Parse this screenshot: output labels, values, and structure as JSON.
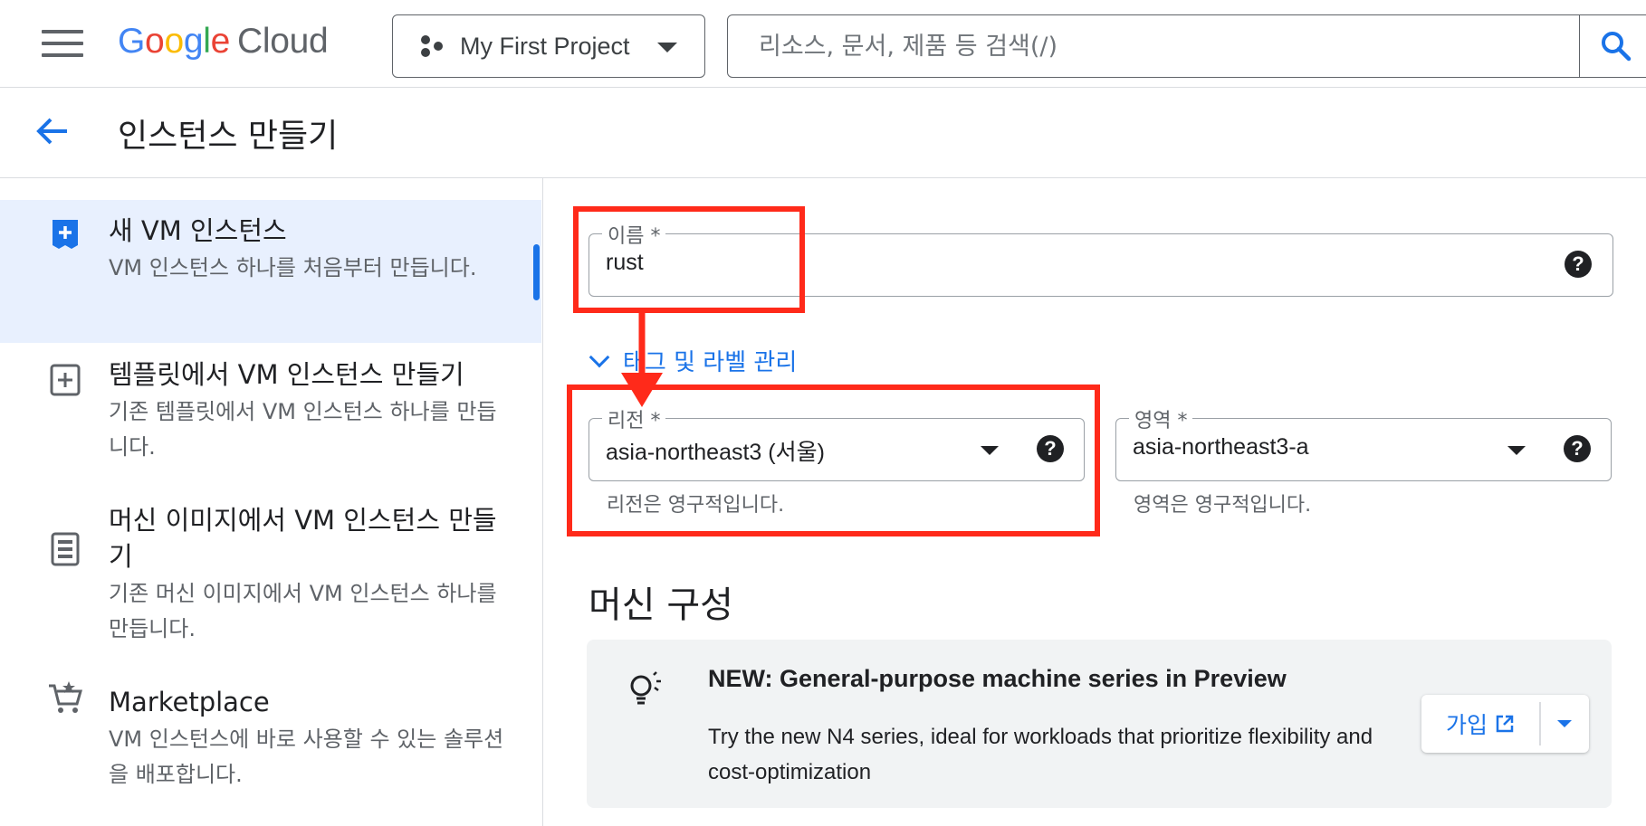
{
  "header": {
    "logo_parts": [
      "G",
      "o",
      "o",
      "g",
      "l",
      "e"
    ],
    "logo_product": "Cloud",
    "project_name": "My First Project",
    "search_placeholder": "리소스, 문서, 제품 등 검색(/)"
  },
  "page": {
    "title": "인스턴스 만들기"
  },
  "sidebar": {
    "items": [
      {
        "title": "새 VM 인스턴스",
        "desc": "VM 인스턴스 하나를 처음부터 만듭니다.",
        "icon": "add-box-icon",
        "selected": true
      },
      {
        "title": "템플릿에서 VM 인스턴스 만들기",
        "desc": "기존 템플릿에서 VM 인스턴스 하나를 만듭니다.",
        "icon": "template-add-icon",
        "selected": false
      },
      {
        "title": "머신 이미지에서 VM 인스턴스 만들기",
        "desc": "기존 머신 이미지에서 VM 인스턴스 하나를 만듭니다.",
        "icon": "machine-image-icon",
        "selected": false
      },
      {
        "title": "Marketplace",
        "desc": "VM 인스턴스에 바로 사용할 수 있는 솔루션을 배포합니다.",
        "icon": "marketplace-cart-icon",
        "selected": false
      }
    ]
  },
  "form": {
    "name": {
      "label": "이름 *",
      "value": "rust",
      "help": "?"
    },
    "tag_link": "태그 및 라벨 관리",
    "region": {
      "label": "리전 *",
      "value": "asia-northeast3 (서울)",
      "hint": "리전은 영구적입니다.",
      "help": "?"
    },
    "zone": {
      "label": "영역 *",
      "value": "asia-northeast3-a",
      "hint": "영역은 영구적입니다.",
      "help": "?"
    }
  },
  "machine_config": {
    "section_title": "머신 구성",
    "banner_title": "NEW: General-purpose machine series in Preview",
    "banner_text": "Try the new N4 series, ideal for workloads that prioritize flexibility and cost-optimization",
    "join_label": "가입"
  },
  "colors": {
    "accent": "#1a73e8",
    "annotation": "#ff2a1a",
    "selected_bg": "#e8f0fe"
  }
}
